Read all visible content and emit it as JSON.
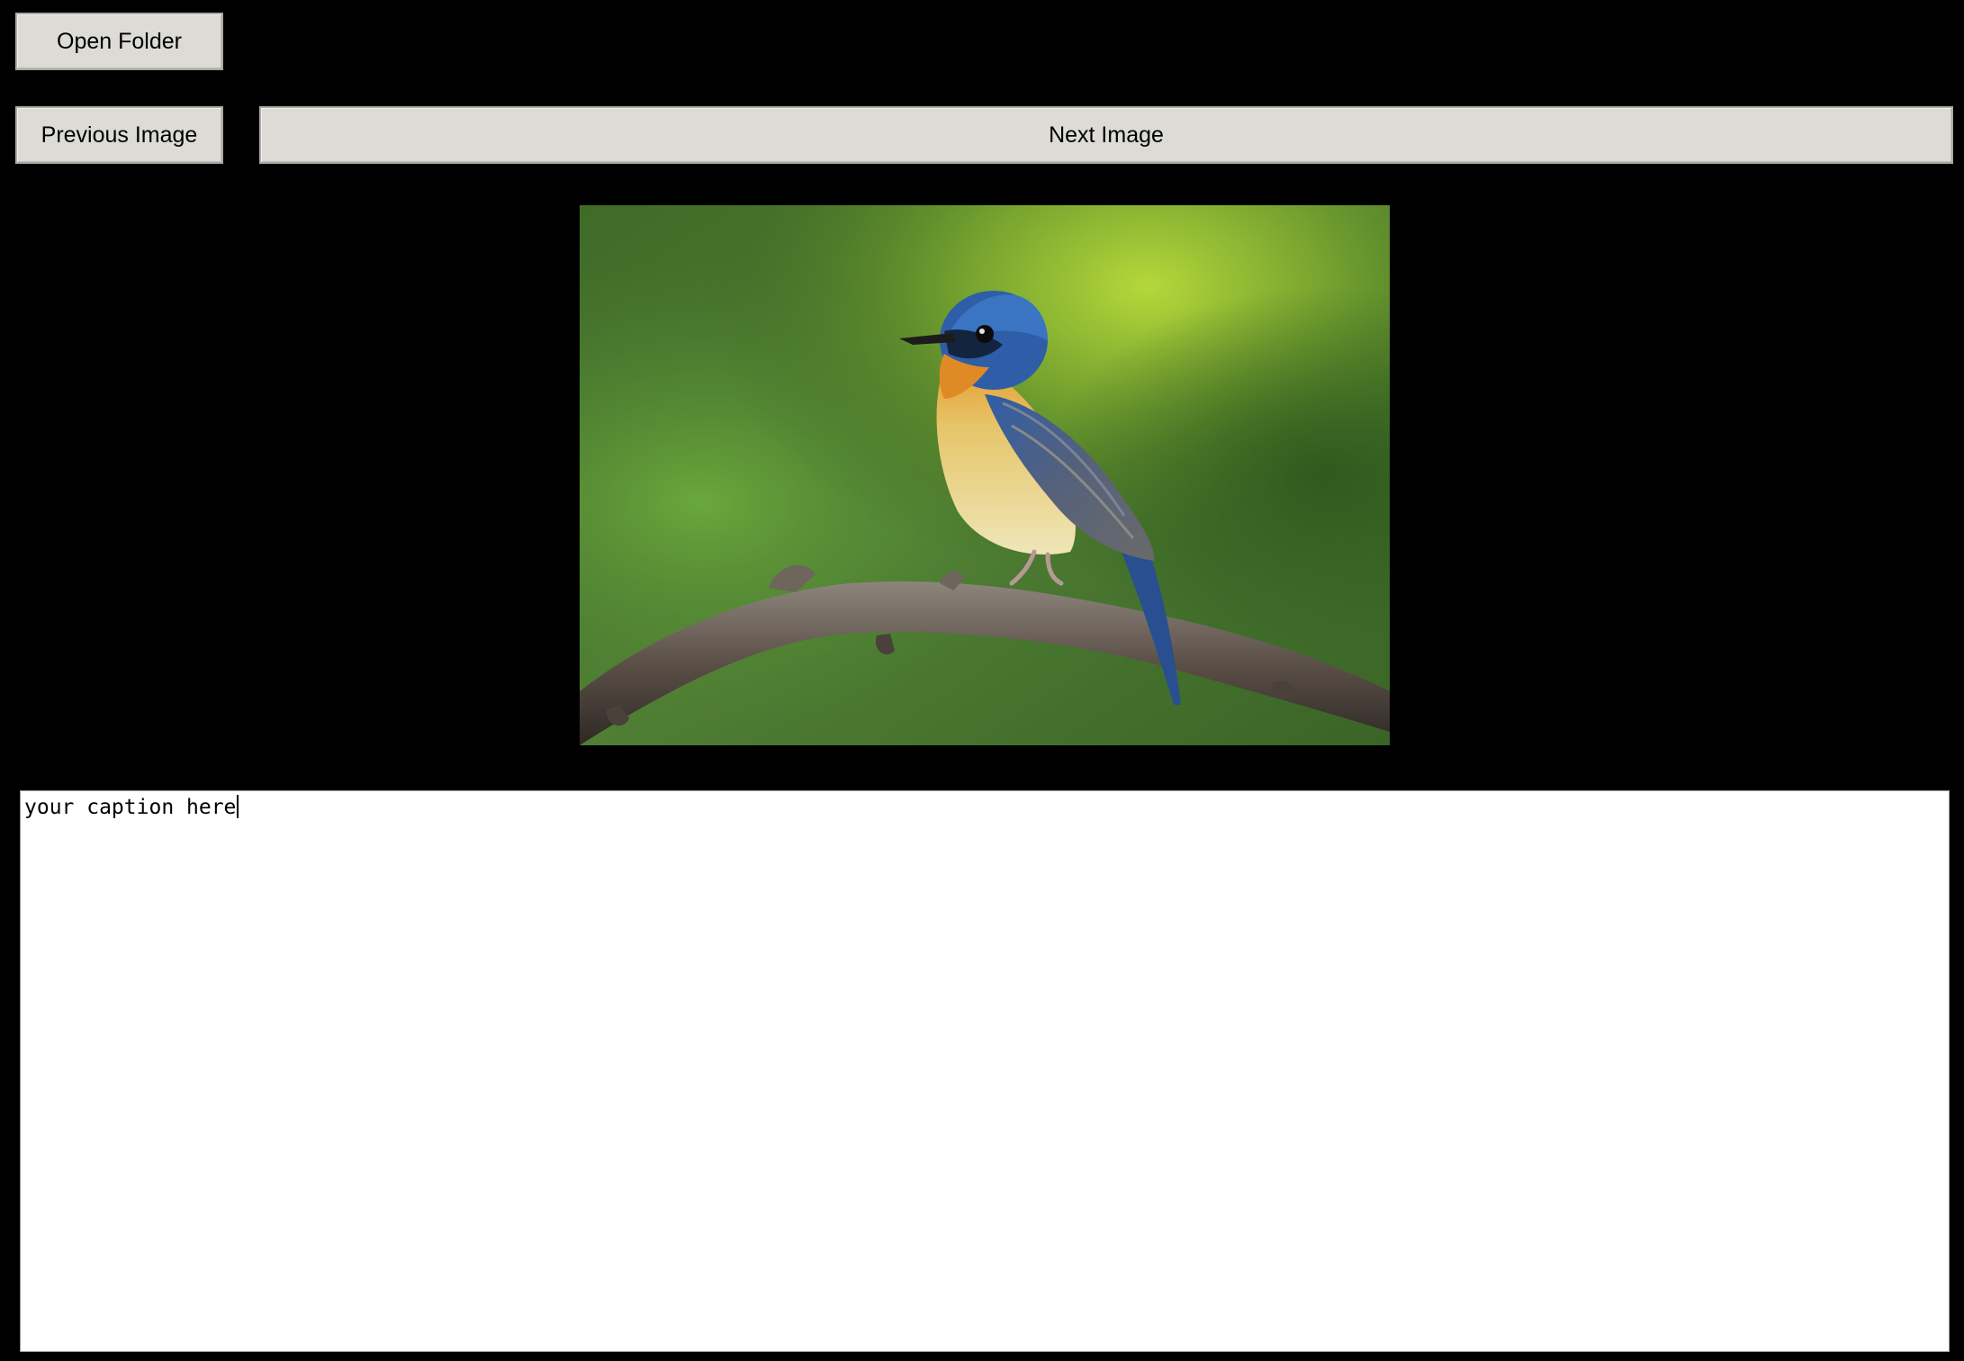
{
  "toolbar": {
    "open_folder_label": "Open Folder",
    "previous_image_label": "Previous Image",
    "next_image_label": "Next Image"
  },
  "viewer": {
    "image_subject": "blue flycatcher bird perched on branch"
  },
  "caption": {
    "value": "your caption here"
  },
  "colors": {
    "background": "#000000",
    "button_face": "#dcdbd6",
    "caption_background": "#ffffff"
  },
  "icons": {
    "caret": "text-cursor-icon"
  }
}
